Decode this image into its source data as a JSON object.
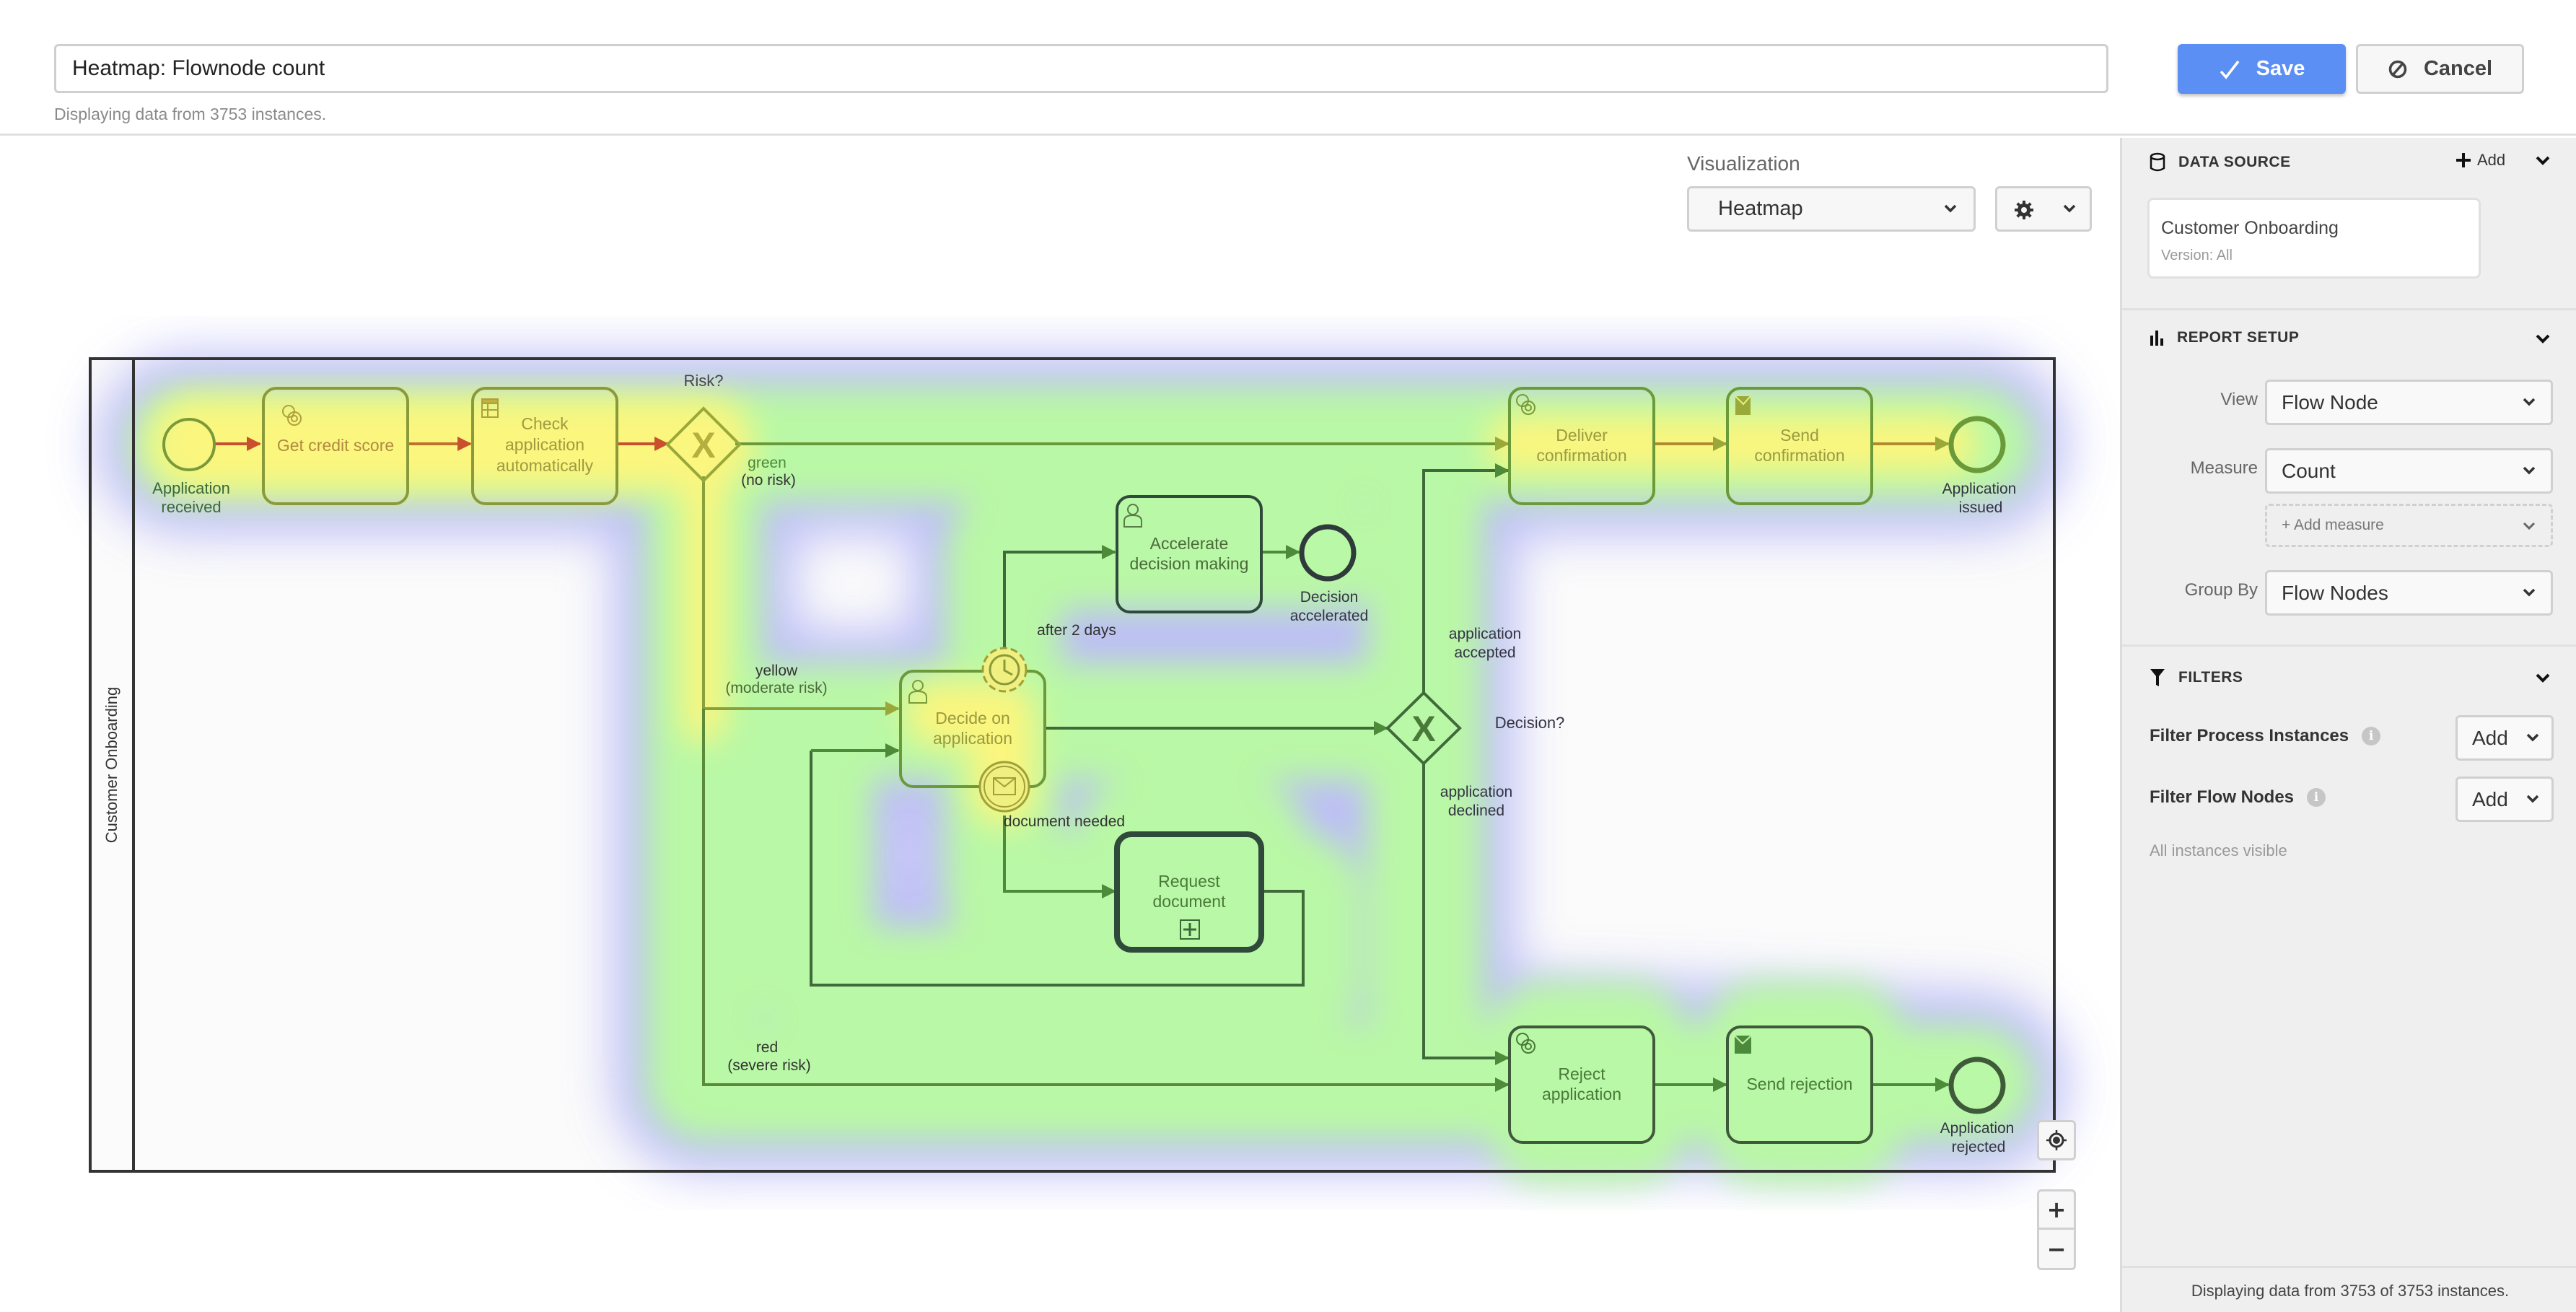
{
  "header": {
    "report_name": "Heatmap: Flownode count",
    "subtitle": "Displaying data from 3753 instances.",
    "save_label": "Save",
    "cancel_label": "Cancel"
  },
  "visualization": {
    "label": "Visualization",
    "selected": "Heatmap",
    "settings_icon": "gear-icon"
  },
  "diagram": {
    "pool_label": "Customer Onboarding",
    "heat_colors": {
      "low": "#b8b8ff",
      "mid": "#b6f7a0",
      "high": "#fff680",
      "max": "#e8563a"
    },
    "nodes": {
      "start": {
        "label_1": "Application",
        "label_2": "received",
        "heat": 0.95
      },
      "get_credit": {
        "label": "Get credit score",
        "type": "service-task",
        "heat": 0.9
      },
      "check_app": {
        "label_1": "Check",
        "label_2": "application",
        "label_3": "automatically",
        "type": "business-rule-task",
        "heat": 0.85
      },
      "risk_gw": {
        "label": "Risk?",
        "type": "exclusive-gateway",
        "heat": 0.8
      },
      "decide": {
        "label_1": "Decide on",
        "label_2": "application",
        "type": "user-task",
        "heat": 0.55
      },
      "timer": {
        "label": "after 2 days",
        "type": "timer-boundary",
        "heat": 0.5
      },
      "msg_boundary": {
        "label": "document needed",
        "type": "message-boundary",
        "heat": 0.5
      },
      "accelerate": {
        "label_1": "Accelerate",
        "label_2": "decision making",
        "type": "user-task",
        "heat": 0.3
      },
      "decision_accel": {
        "label_1": "Decision",
        "label_2": "accelerated",
        "type": "end-event",
        "heat": 0.2
      },
      "request_doc": {
        "label_1": "Request",
        "label_2": "document",
        "type": "subprocess",
        "heat": 0.35
      },
      "decision_gw": {
        "label": "Decision?",
        "type": "exclusive-gateway",
        "heat": 0.35
      },
      "deliver": {
        "label_1": "Deliver",
        "label_2": "confirmation",
        "type": "service-task",
        "heat": 0.55
      },
      "send_conf": {
        "label_1": "Send",
        "label_2": "confirmation",
        "type": "send-task",
        "heat": 0.55
      },
      "issued": {
        "label_1": "Application",
        "label_2": "issued",
        "type": "end-event",
        "heat": 0.45
      },
      "reject": {
        "label_1": "Reject",
        "label_2": "application",
        "type": "service-task",
        "heat": 0.35
      },
      "send_rej": {
        "label": "Send rejection",
        "type": "send-task",
        "heat": 0.35
      },
      "rejected": {
        "label_1": "Application",
        "label_2": "rejected",
        "type": "end-event",
        "heat": 0.3
      }
    },
    "flows": {
      "green": {
        "label_1": "green",
        "label_2": "(no risk)"
      },
      "yellow": {
        "label_1": "yellow",
        "label_2": "(moderate risk)"
      },
      "red": {
        "label_1": "red",
        "label_2": "(severe risk)"
      },
      "accepted": {
        "label_1": "application",
        "label_2": "accepted"
      },
      "declined": {
        "label_1": "application",
        "label_2": "declined"
      }
    }
  },
  "map_controls": {
    "recenter_icon": "crosshair-icon",
    "zoom_in": "+",
    "zoom_out": "−"
  },
  "sidebar": {
    "data_source": {
      "title": "DATA SOURCE",
      "add_label": "Add",
      "process_name": "Customer Onboarding",
      "version": "Version: All"
    },
    "report_setup": {
      "title": "REPORT SETUP",
      "view_label": "View",
      "view_value": "Flow Node",
      "measure_label": "Measure",
      "measure_value": "Count",
      "add_measure": "+ Add measure",
      "group_by_label": "Group By",
      "group_by_value": "Flow Nodes"
    },
    "filters": {
      "title": "FILTERS",
      "process_instances_label": "Filter Process Instances",
      "flow_nodes_label": "Filter Flow Nodes",
      "add_label": "Add",
      "status": "All instances visible"
    },
    "footer": "Displaying data from 3753 of 3753 instances."
  }
}
